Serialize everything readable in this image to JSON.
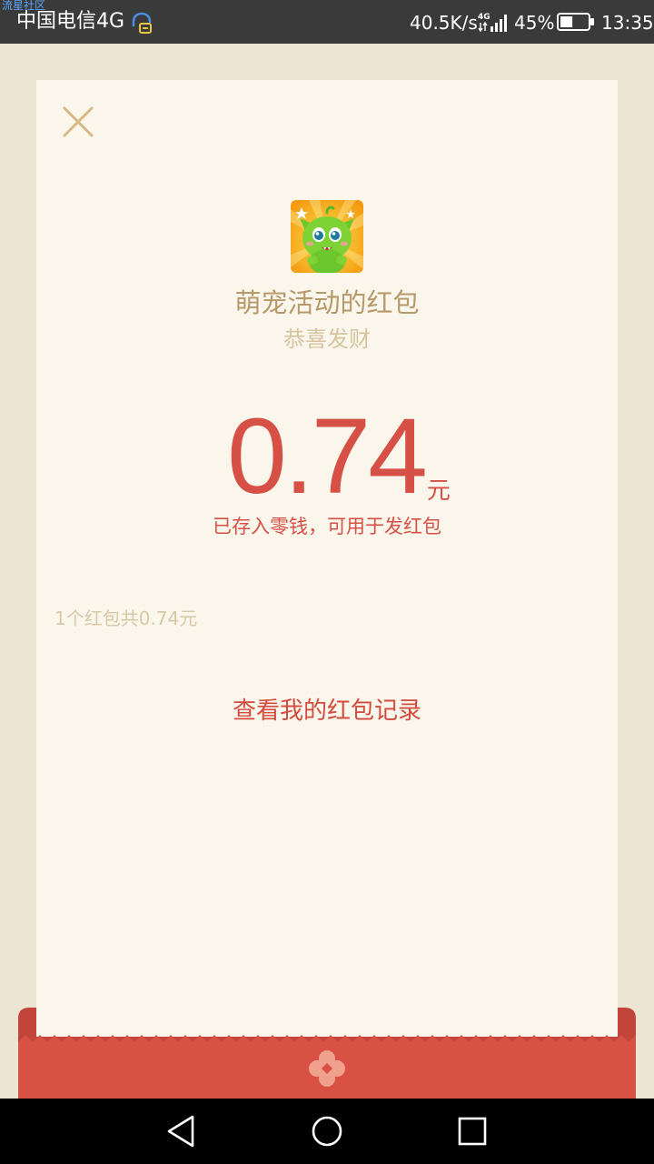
{
  "status_bar": {
    "watermark": "流星社区",
    "carrier": "中国电信4G",
    "net_speed": "40.5K/s",
    "network_type": "4G",
    "battery_percent": "45%",
    "battery_level": 0.45,
    "time": "13:35",
    "icons": [
      "hd-voice-icon",
      "signal-icon",
      "battery-icon"
    ]
  },
  "red_packet": {
    "sender_name": "萌宠活动的红包",
    "wish_text": "恭喜发财",
    "amount": "0.74",
    "unit": "元",
    "saved_note": "已存入零钱，可用于发红包",
    "summary": "1个红包共0.74元",
    "records_link": "查看我的红包记录"
  },
  "icons": {
    "close": "close-icon",
    "avatar": "pet-avatar-icon",
    "envelope_emblem": "flower-icon"
  },
  "navigation": {
    "back": "back-icon",
    "home": "home-icon",
    "recents": "recents-icon"
  },
  "colors": {
    "background": "#ece5d3",
    "card": "#faf6eb",
    "accent_red": "#d65046",
    "gold_text": "#b79a6a",
    "status_bar": "#3a3a3a"
  }
}
